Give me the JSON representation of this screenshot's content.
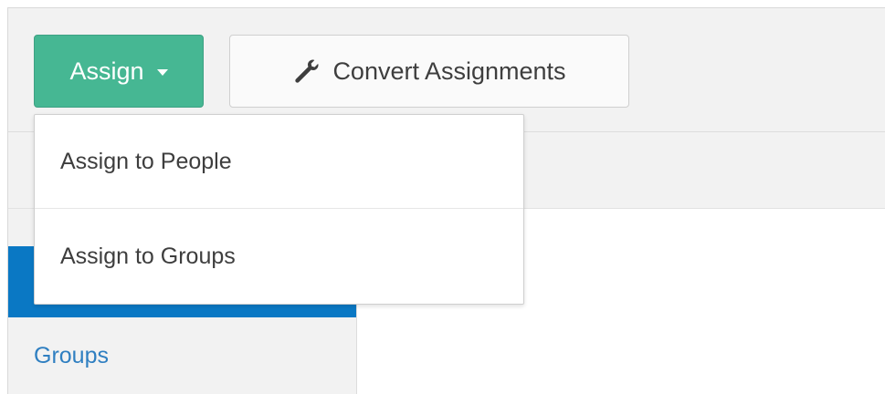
{
  "toolbar": {
    "assign_label": "Assign",
    "convert_label": "Convert Assignments"
  },
  "assign_menu": {
    "items": [
      {
        "label": "Assign to People"
      },
      {
        "label": "Assign to Groups"
      }
    ]
  },
  "sidebar": {
    "items": [
      {
        "label": ""
      },
      {
        "label": "Groups"
      }
    ]
  },
  "icons": {
    "caret": "chevron-down-icon",
    "convert": "wrench-icon"
  },
  "colors": {
    "assign_button": "#46b793",
    "active_sidebar": "#0a78c4",
    "link": "#2f7fc1",
    "toolbar_bg": "#f2f2f2"
  }
}
